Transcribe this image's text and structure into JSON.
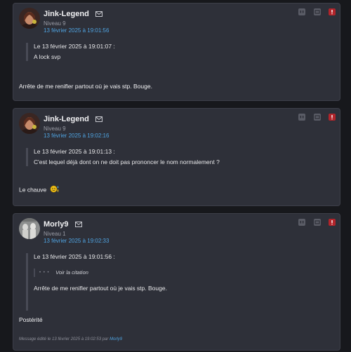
{
  "posts": [
    {
      "author": "Jink-Legend",
      "level": "Niveau 9",
      "date": "13 février 2025 à 19:01:56",
      "quote": {
        "meta": "Le 13 février 2025 à 19:01:07 :",
        "text": "A lock svp"
      },
      "body": "Arrête de me renifler partout où je vais stp. Bouge."
    },
    {
      "author": "Jink-Legend",
      "level": "Niveau 9",
      "date": "13 février 2025 à 19:02:16",
      "quote": {
        "meta": "Le 13 février 2025 à 19:01:13 :",
        "text": "C'est lequel déjà dont on ne doit pas prononcer le nom normalement ?"
      },
      "body": "Le chauve",
      "body_emoji": "smiley-sweat-icon"
    },
    {
      "author": "Morly9",
      "level": "Niveau 1",
      "date": "13 février 2025 à 19:02:33",
      "quote": {
        "meta": "Le 13 février 2025 à 19:01:56 :",
        "nested_dots": "• • •",
        "nested_label": "Voir la citation",
        "text": "Arrête de me renifler partout où je vais stp. Bouge."
      },
      "body": "Postérité",
      "edit_note": {
        "prefix": "Message édité le 13 février 2025 à 19:02:53 par",
        "editor": "Morly9"
      }
    }
  ],
  "icons": {
    "mail": "mail-icon",
    "quote": "quote-icon",
    "private_message": "message-icon",
    "report": "alert-icon"
  },
  "colors": {
    "page_bg": "#17181c",
    "card_bg": "#2e3039",
    "card_border": "#3d3f49",
    "date_link": "#4fa3e0",
    "report_red": "#b2242a"
  }
}
